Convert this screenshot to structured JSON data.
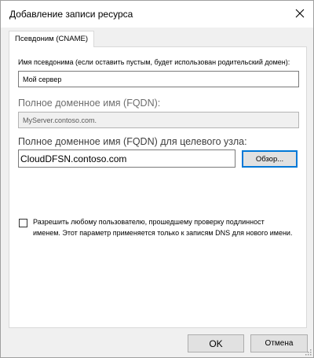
{
  "window": {
    "title": "Добавление записи ресурса"
  },
  "tab": {
    "label": "Псевдоним (CNAME)"
  },
  "alias": {
    "label": "Имя псевдонима (если оставить пустым, будет использован родительский домен):",
    "value": "Мой сервер"
  },
  "fqdn": {
    "label": "Полное доменное имя (FQDN):",
    "value": "MyServer.contoso.com."
  },
  "target": {
    "label": "Полное доменное имя (FQDN) для целевого узла:",
    "value": "CloudDFSN.contoso.com",
    "browse_label": "Обзор..."
  },
  "permission": {
    "checked": false,
    "line1": "Разрешить любому пользователю, прошедшему проверку подлинност",
    "line2": "именем. Этот параметр применяется только к записям DNS для нового имени."
  },
  "footer": {
    "ok_label": "OK",
    "cancel_label": "Отмена"
  },
  "colors": {
    "accent": "#0078d7",
    "window_bg": "#f0f0f0"
  }
}
